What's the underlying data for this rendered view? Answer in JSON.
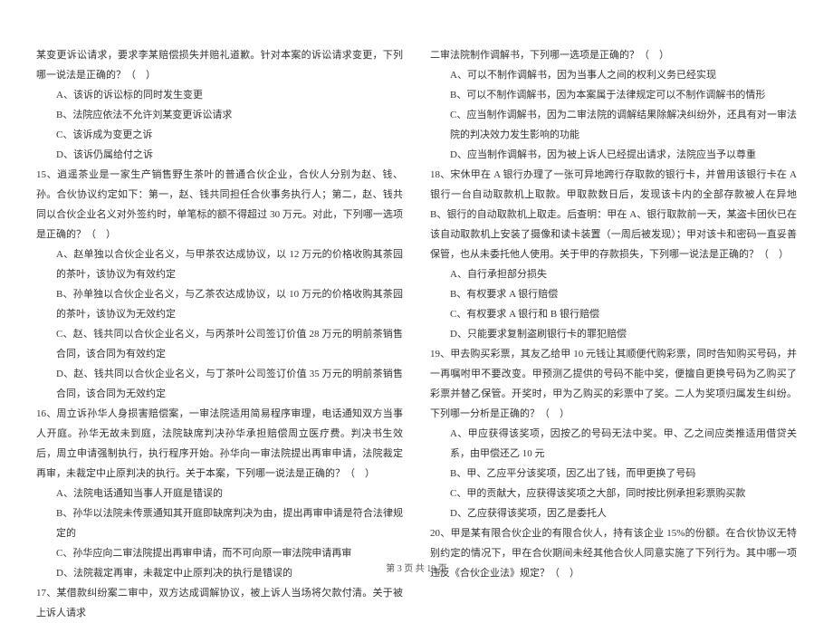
{
  "left": {
    "intro": "某变更诉讼请求，要求李某赔偿损失并赔礼道歉。针对本案的诉讼请求变更，下列哪一说法是正确的？（　）",
    "optA": "A、该诉的诉讼标的同时发生变更",
    "optB": "B、法院应依法不允许刘某变更诉讼请求",
    "optC": "C、该诉成为变更之诉",
    "optD": "D、该诉仍属给付之诉",
    "q15": "15、逍遥茶业是一家生产销售野生茶叶的普通合伙企业，合伙人分别为赵、钱、孙。合伙协议约定如下：第一，赵、钱共同担任合伙事务执行人；第二，赵、钱共同以合伙企业名义对外签约时，单笔标的额不得超过 30 万元。对此，下列哪一选项是正确的？（　）",
    "q15A": "A、赵单独以合伙企业名义，与甲茶农达成协议，以 12 万元的价格收购其茶园的茶叶，该协议为有效约定",
    "q15B": "B、孙单独以合伙企业名义，与乙茶农达成协议，以 10 万元的价格收购其茶园的茶叶，该协议为无效约定",
    "q15C": "C、赵、钱共同以合伙企业名义，与丙茶叶公司签订价值 28 万元的明前茶销售合同，该合同为有效约定",
    "q15D": "D、赵、钱共同以合伙企业名义，与丁茶叶公司签订价值 35 万元的明前茶销售合同，该合同为无效约定",
    "q16": "16、周立诉孙华人身损害赔偿案，一审法院适用简易程序审理，电话通知双方当事人开庭。孙华无故未到庭，法院缺席判决孙华承担赔偿周立医疗费。判决书生效后，周立申请强制执行，执行程序开始。孙华向一审法院提出再审申请，法院裁定再审，未裁定中止原判决的执行。关于本案，下列哪一说法是正确的？（　）",
    "q16A": "A、法院电话通知当事人开庭是错误的",
    "q16B": "B、孙华以法院未传票通知其开庭即缺席判决为由，提出再审申请是符合法律规定的",
    "q16C": "C、孙华应向二审法院提出再审申请，而不可向原一审法院申请再审",
    "q16D": "D、法院裁定再审，未裁定中止原判决的执行是错误的",
    "q17": "17、某借款纠纷案二审中，双方达成调解协议，被上诉人当场将欠款付清。关于被上诉人请求"
  },
  "right": {
    "intro": "二审法院制作调解书，下列哪一选项是正确的？（　）",
    "optA": "A、可以不制作调解书，因为当事人之间的权利义务已经实现",
    "optB": "B、可以不制作调解书，因为本案属于法律规定可以不制作调解书的情形",
    "optC": "C、应当制作调解书，因为二审法院的调解结果除解决纠纷外，还具有对一审法院的判决效力发生影响的功能",
    "optD": "D、应当制作调解书，因为被上诉人已经提出请求，法院应当予以尊重",
    "q18": "18、宋休甲在 A 银行办理了一张可异地跨行存取款的银行卡，并曾用该银行卡在 A 银行一台自动取款机上取款。甲取款数日后，发现该卡内的全部存款被人在异地 B、银行的自动取款机上取走。后查明：甲在 A、银行取款前一天，某盗卡团伙已在该自动取款机上安装了摄像和读卡装置（一周后被发现）；甲对该卡和密码一直妥善保管，也从未委托他人使用。关于甲的存款损失，下列哪一说法是正确的？（　）",
    "q18A": "A、自行承担部分损失",
    "q18B": "B、有权要求 A 银行赔偿",
    "q18C": "C、有权要求 A 银行和 B 银行赔偿",
    "q18D": "D、只能要求复制盗刷银行卡的罪犯赔偿",
    "q19": "19、甲去购买彩票，其友乙给甲 10 元钱让其顺便代购彩票，同时告知购买号码，并一再嘱咐甲不要改变。甲预测乙提供的号码不能中奖，便擅自更换号码为乙购买了彩票并替乙保管。开奖时，甲为乙购买的彩票中了奖。二人为奖项归属发生纠纷。下列哪一分析是正确的？（　）",
    "q19A": "A、甲应获得该奖项，因按乙的号码无法中奖。甲、乙之间应类推适用借贷关系，由甲偿还乙 10 元",
    "q19B": "B、甲、乙应平分该奖项，因乙出了钱，而甲更换了号码",
    "q19C": "C、甲的贡献大，应获得该奖项之大部，同时按比例承担彩票购买款",
    "q19D": "D、乙应获得该奖项，因乙是委托人",
    "q20": "20、甲是某有限合伙企业的有限合伙人，持有该企业 15%的份额。在合伙协议无特别约定的情况下，甲在合伙期间未经其他合伙人同意实施了下列行为。其中哪一项违反《合伙企业法》规定？（　）"
  },
  "footer": "第 3 页 共 19 页"
}
